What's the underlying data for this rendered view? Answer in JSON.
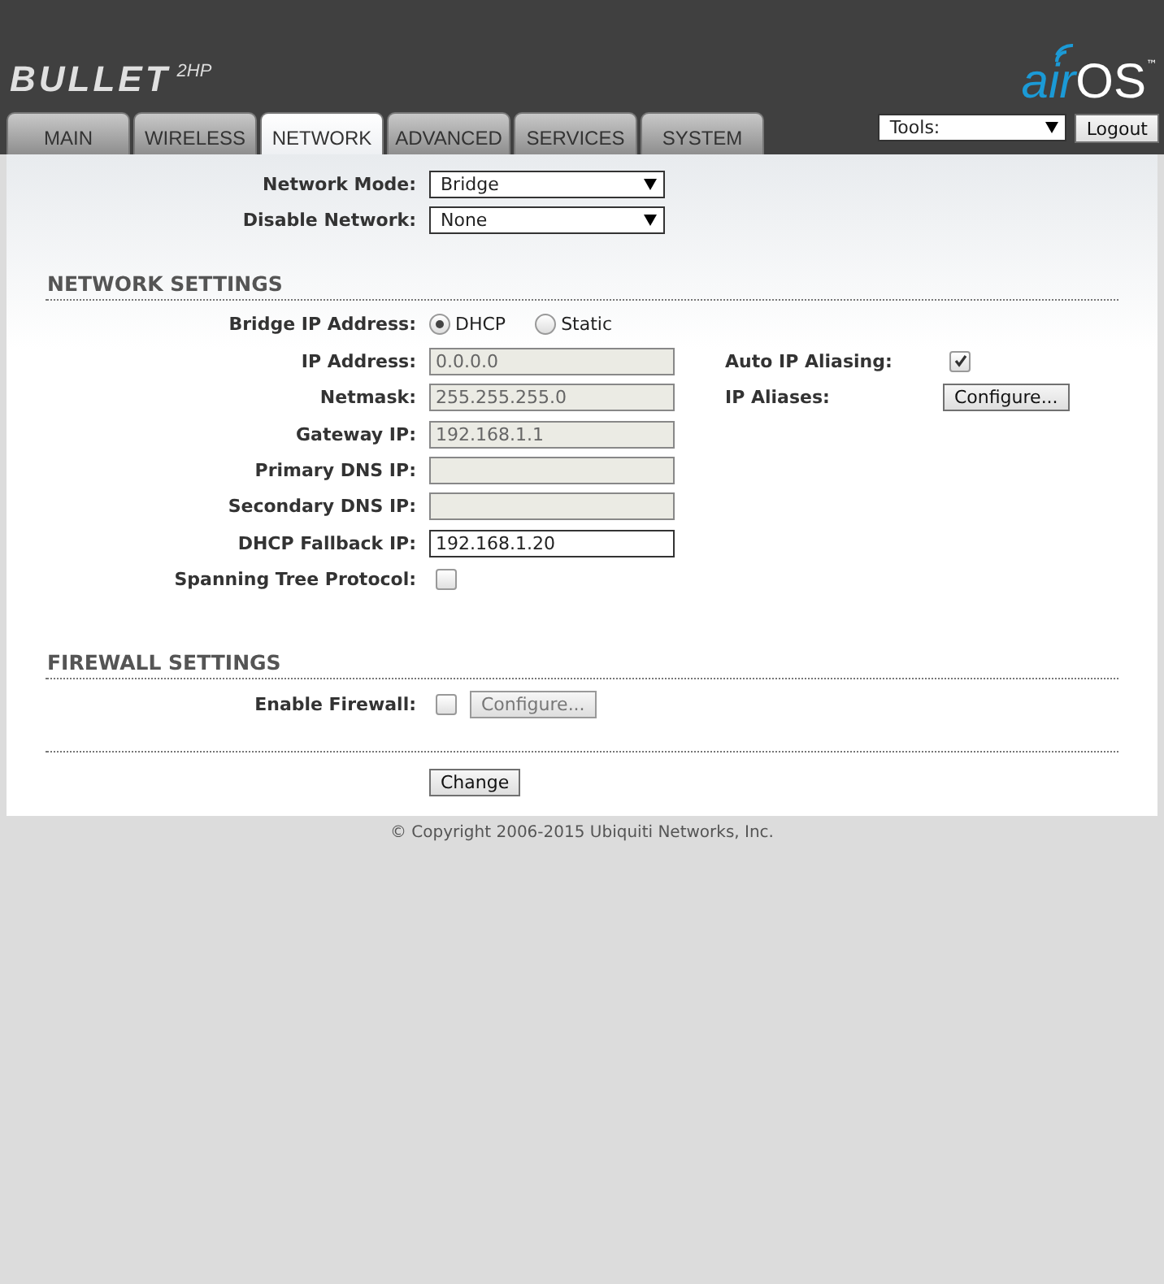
{
  "header": {
    "product": "BULLET",
    "model": "2HP",
    "brand_air": "air",
    "brand_os": "OS",
    "trademark": "™"
  },
  "tabs": [
    {
      "label": "MAIN",
      "selected": false
    },
    {
      "label": "WIRELESS",
      "selected": false
    },
    {
      "label": "NETWORK",
      "selected": true
    },
    {
      "label": "ADVANCED",
      "selected": false
    },
    {
      "label": "SERVICES",
      "selected": false
    },
    {
      "label": "SYSTEM",
      "selected": false
    }
  ],
  "tools": {
    "value": "Tools:"
  },
  "logout": "Logout",
  "top_rows": [
    {
      "label": "Network Mode:",
      "kind": "select",
      "value": "Bridge"
    },
    {
      "label": "Disable Network:",
      "kind": "select",
      "value": "None"
    }
  ],
  "network_settings": {
    "title": "NETWORK SETTINGS",
    "rows": [
      {
        "label": "Bridge IP Address:",
        "kind": "radio",
        "options": [
          {
            "label": "DHCP",
            "selected": true
          },
          {
            "label": "Static",
            "selected": false
          }
        ]
      },
      {
        "label": "IP Address:",
        "kind": "text",
        "value": "0.0.0.0",
        "disabled": true,
        "side": {
          "label": "Auto IP Aliasing:",
          "kind": "checkbox",
          "checked": true
        }
      },
      {
        "label": "Netmask:",
        "kind": "text",
        "value": "255.255.255.0",
        "disabled": true,
        "side": {
          "label": "IP Aliases:",
          "kind": "button",
          "button": "Configure...",
          "disabled": false
        }
      },
      {
        "label": "Gateway IP:",
        "kind": "text",
        "value": "192.168.1.1",
        "disabled": true
      },
      {
        "label": "Primary DNS IP:",
        "kind": "text",
        "disabled": true
      },
      {
        "label": "Secondary DNS IP:",
        "kind": "text",
        "disabled": true
      },
      {
        "label": "DHCP Fallback IP:",
        "kind": "text",
        "value": "192.168.1.20",
        "disabled": false
      },
      {
        "label": "Spanning Tree Protocol:",
        "kind": "checkbox",
        "checked": false
      }
    ]
  },
  "firewall_settings": {
    "title": "FIREWALL SETTINGS",
    "rows": [
      {
        "label": "Enable Firewall:",
        "kind": "checkbox",
        "checked": false,
        "button": "Configure...",
        "button_disabled": true
      }
    ]
  },
  "change_button": "Change",
  "footer": "© Copyright 2006-2015 Ubiquiti Networks, Inc."
}
